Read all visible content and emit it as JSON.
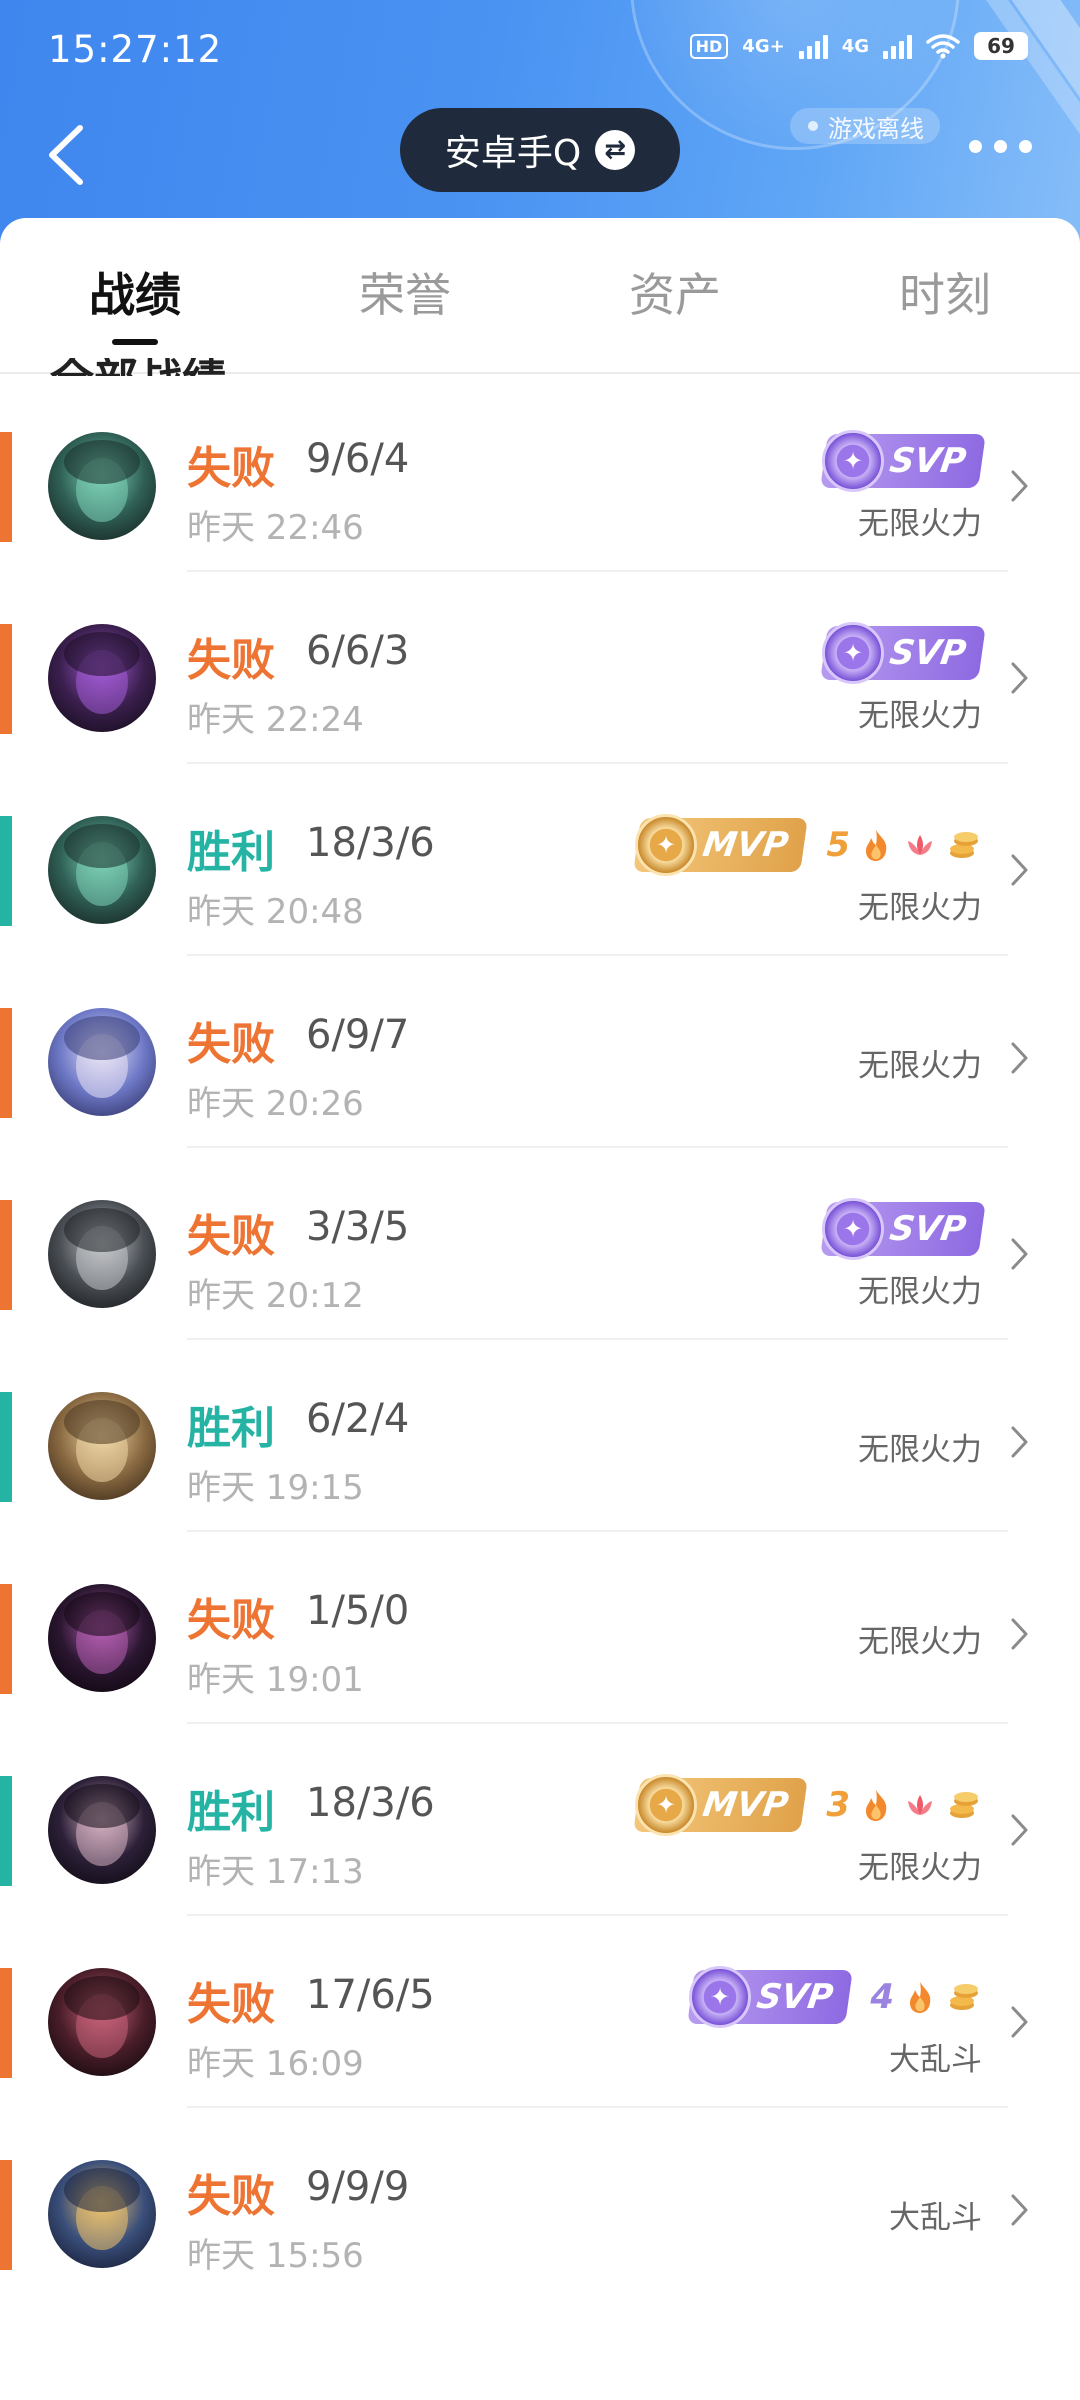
{
  "status_bar": {
    "time": "15:27:12",
    "network_hd": "HD",
    "net_1": "4G+",
    "net_2": "4G",
    "battery": "69"
  },
  "header": {
    "account_name": "安卓手Q",
    "offline_label": "游戏离线",
    "back_icon": "chevron-left-icon",
    "more_icon": "more-dots-icon",
    "swap_icon": "swap-icon"
  },
  "tabs": [
    {
      "label": "战绩",
      "active": true
    },
    {
      "label": "荣誉",
      "active": false
    },
    {
      "label": "资产",
      "active": false
    },
    {
      "label": "时刻",
      "active": false
    }
  ],
  "section_title": "全部战绩",
  "colors": {
    "loss": "#ee7434",
    "win": "#25b3a3",
    "header_blue": "#4a93f2",
    "svp_purple": "#8e6ae2",
    "mvp_gold": "#e0a24a"
  },
  "matches": [
    {
      "result": "失败",
      "outcome": "loss",
      "kda": "9/6/4",
      "time": "昨天 22:46",
      "mode": "无限火力",
      "badge": "SVP",
      "extras": []
    },
    {
      "result": "失败",
      "outcome": "loss",
      "kda": "6/6/3",
      "time": "昨天 22:24",
      "mode": "无限火力",
      "badge": "SVP",
      "extras": []
    },
    {
      "result": "胜利",
      "outcome": "win",
      "kda": "18/3/6",
      "time": "昨天 20:48",
      "mode": "无限火力",
      "badge": "MVP",
      "extras": [
        "5",
        "fire-icon",
        "lotus-icon",
        "coins-icon"
      ]
    },
    {
      "result": "失败",
      "outcome": "loss",
      "kda": "6/9/7",
      "time": "昨天 20:26",
      "mode": "无限火力",
      "badge": "",
      "extras": []
    },
    {
      "result": "失败",
      "outcome": "loss",
      "kda": "3/3/5",
      "time": "昨天 20:12",
      "mode": "无限火力",
      "badge": "SVP",
      "extras": []
    },
    {
      "result": "胜利",
      "outcome": "win",
      "kda": "6/2/4",
      "time": "昨天 19:15",
      "mode": "无限火力",
      "badge": "",
      "extras": []
    },
    {
      "result": "失败",
      "outcome": "loss",
      "kda": "1/5/0",
      "time": "昨天 19:01",
      "mode": "无限火力",
      "badge": "",
      "extras": []
    },
    {
      "result": "胜利",
      "outcome": "win",
      "kda": "18/3/6",
      "time": "昨天 17:13",
      "mode": "无限火力",
      "badge": "MVP",
      "extras": [
        "3",
        "fire-icon",
        "lotus-icon",
        "coins-icon"
      ]
    },
    {
      "result": "失败",
      "outcome": "loss",
      "kda": "17/6/5",
      "time": "昨天 16:09",
      "mode": "大乱斗",
      "badge": "SVP",
      "extras": [
        "4",
        "fire-icon",
        "coins-icon"
      ]
    },
    {
      "result": "失败",
      "outcome": "loss",
      "kda": "9/9/9",
      "time": "昨天 15:56",
      "mode": "大乱斗",
      "badge": "",
      "extras": []
    }
  ]
}
